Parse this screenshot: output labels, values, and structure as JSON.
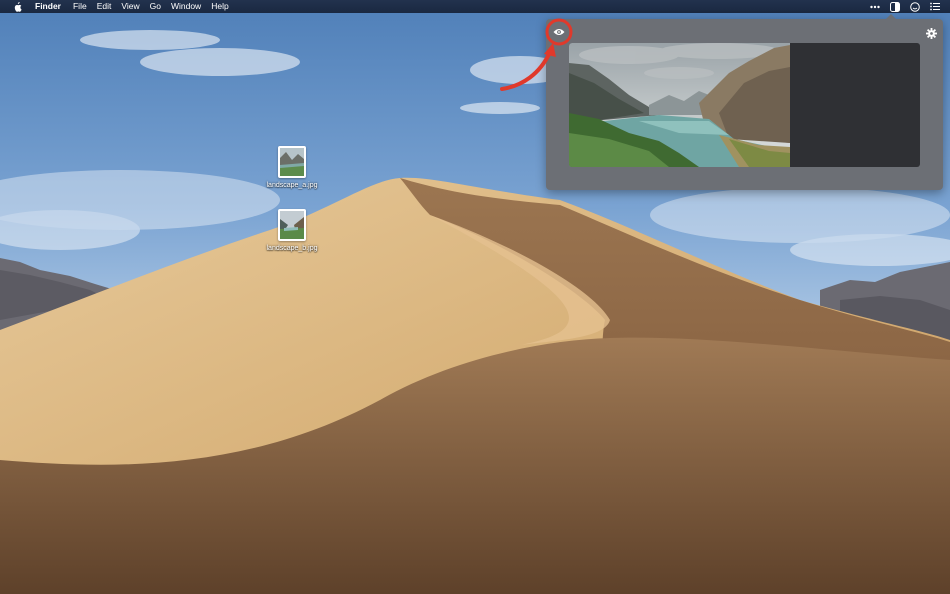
{
  "menubar": {
    "apple_icon": "apple-logo-icon",
    "app_name": "Finder",
    "menus": [
      "File",
      "Edit",
      "View",
      "Go",
      "Window",
      "Help"
    ],
    "status_icons": [
      "more-dots-icon",
      "split-view-icon",
      "smiley-icon",
      "list-icon"
    ]
  },
  "desktop": {
    "files": [
      {
        "name": "landscape_a.jpg"
      },
      {
        "name": "landscape_b.jpg"
      }
    ]
  },
  "popover": {
    "eye_icon": "eye-icon",
    "settings_icon": "gear-icon",
    "highlight_color": "#e0392b"
  }
}
